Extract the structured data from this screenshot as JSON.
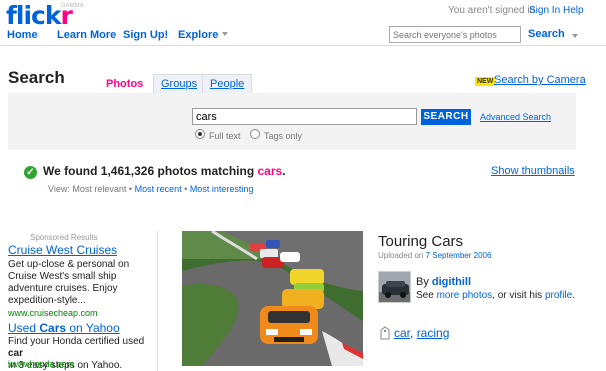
{
  "header": {
    "logo_main": "flick",
    "logo_r": "r",
    "beta": "GAMMA",
    "not_signed_in": "You aren't signed in",
    "sign_in": "Sign In",
    "help": "Help",
    "nav": [
      "Home",
      "Learn More",
      "Sign Up!",
      "Explore"
    ],
    "search_placeholder": "Search everyone's photos",
    "search_button": "Search"
  },
  "search": {
    "title": "Search",
    "tabs": [
      "Photos",
      "Groups",
      "People"
    ],
    "active_tab": "Photos",
    "new_badge": "NEW",
    "camera_link": "Search by Camera",
    "query": "cars",
    "button": "SEARCH",
    "advanced": "Advanced Search",
    "options": [
      "Full text",
      "Tags only"
    ],
    "selected_option": "Full text"
  },
  "results": {
    "found_prefix": "We found 1,461,326 photos matching ",
    "found_term": "cars",
    "found_suffix": ".",
    "show_thumbnails": "Show thumbnails",
    "view_label": "View:",
    "view_current": "Most relevant",
    "view_sep": "•",
    "view_recent": "Most recent",
    "view_interesting": "Most interesting"
  },
  "sponsored": {
    "label": "Sponsored Results",
    "ads": [
      {
        "title": "Cruise West Cruises",
        "desc": [
          "Get up-close & personal on",
          "Cruise West's small ship",
          "adventure cruises. Enjoy",
          "expedition-style..."
        ],
        "url": "www.cruisecheap.com"
      },
      {
        "title_pre": "Used ",
        "title_bold": "Cars",
        "title_post": " on Yahoo",
        "desc_pre": "Find your Honda certified used ",
        "desc_bold": "car",
        "desc_line2": "in 3 easy steps on Yahoo.",
        "url": "www.honda.com"
      }
    ]
  },
  "photo": {
    "title": "Touring Cars",
    "uploaded_prefix": "Uploaded on ",
    "uploaded_date": "7 September 2006",
    "by": "By",
    "owner": "digithill",
    "see_prefix": "See ",
    "more_photos": "more photos",
    "see_mid": ", or visit his ",
    "profile": "profile",
    "see_suffix": ".",
    "tags": [
      "car",
      "racing"
    ],
    "tag_sep": ", "
  },
  "colors": {
    "link": "#0063dc",
    "pink": "#ff0084",
    "search_button": "#0063dc",
    "check": "#2fa52f"
  }
}
